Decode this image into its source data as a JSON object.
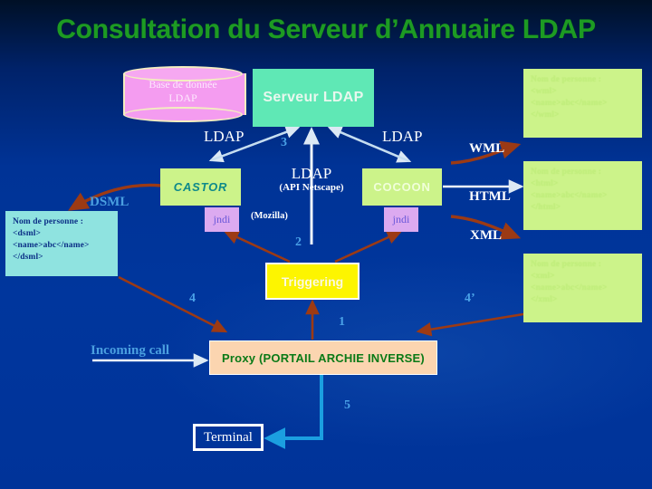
{
  "title": "Consultation du Serveur d’Annuaire LDAP",
  "colors": {
    "background_top": "#001026",
    "background_bottom": "#003399",
    "title_green": "#1d9b23",
    "db_pink": "#f49cf0",
    "server_mint": "#5fe8b5",
    "lime": "#ccf38a",
    "jndi_violet": "#dcaaf0",
    "trigger_yellow": "#fdf500",
    "proxy_peach": "#fbd5b0",
    "dsml_cyan": "#8fe3e0",
    "arrow_brown": "#9c3a14",
    "arrow_white": "#dce9f5",
    "arrow_cyan": "#1b9fe0",
    "number_blue": "#4aa2e8"
  },
  "nodes": {
    "database": {
      "line1": "Base de donnée",
      "line2": "LDAP"
    },
    "server": {
      "label": "Serveur LDAP"
    },
    "castor": {
      "label": "CASTOR"
    },
    "cocoon": {
      "label": "COCOON"
    },
    "jndi_left": {
      "label": "jndi"
    },
    "jndi_right": {
      "label": "jndi"
    },
    "triggering": {
      "label": "Triggering"
    },
    "proxy": {
      "label": "Proxy (PORTAIL ARCHIE INVERSE)"
    },
    "terminal": {
      "label": "Terminal"
    }
  },
  "result_boxes": {
    "wml": {
      "lines": [
        "Nom de personne :",
        "<wml>",
        "<name>abc</name>",
        "</wml>"
      ]
    },
    "html": {
      "lines": [
        "Nom de personne :",
        "<html>",
        "<name>abc</name>",
        "</html>"
      ]
    },
    "xml": {
      "lines": [
        "Nom de personne :",
        "<xml>",
        "<name>abc</name>",
        "</xml>"
      ]
    },
    "dsml": {
      "lines": [
        "Nom de personne :",
        "<dsml>",
        "<name>abc</name>",
        "</dsml>"
      ]
    }
  },
  "labels": {
    "ldap_left": "LDAP",
    "ldap_right": "LDAP",
    "ldap_api": "LDAP",
    "api_netscape": "(API Netscape)",
    "mozilla": "(Mozilla)",
    "wml": "WML",
    "html": "HTML",
    "xml": "XML",
    "dsml": "DSML",
    "incoming_call": "Incoming call"
  },
  "step_numbers": {
    "one": "1",
    "two": "2",
    "three": "3",
    "four": "4",
    "four_prime": "4’",
    "five": "5"
  }
}
